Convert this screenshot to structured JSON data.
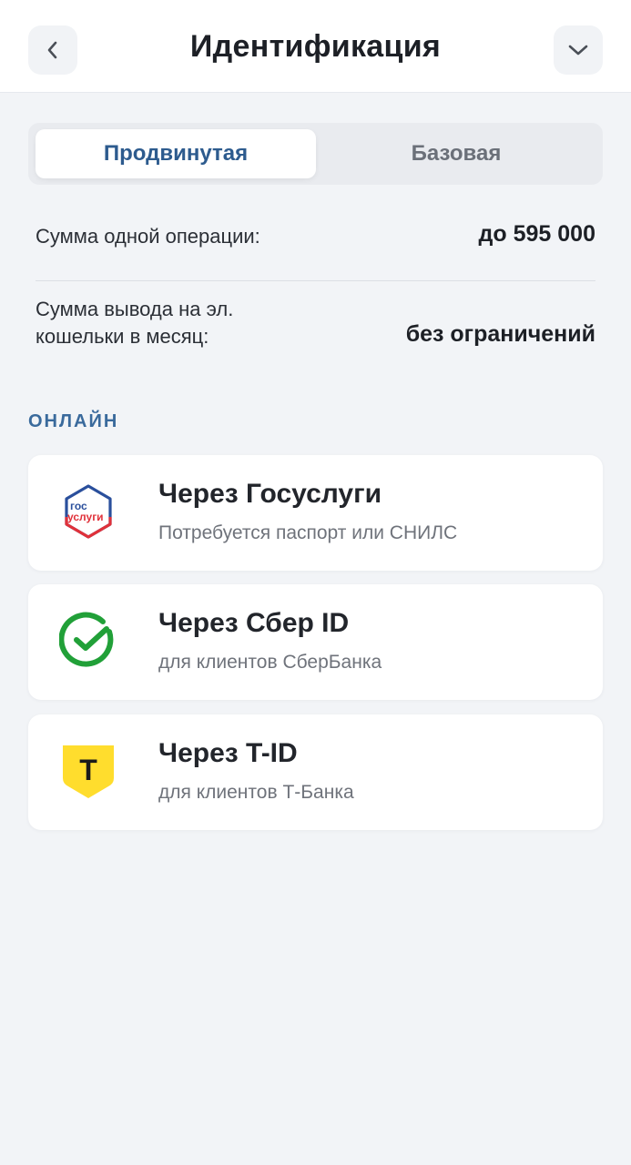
{
  "header": {
    "title": "Идентификация",
    "back_icon": "chevron-left-icon",
    "menu_icon": "chevron-down-icon"
  },
  "tabs": [
    {
      "label": "Продвинутая",
      "active": true
    },
    {
      "label": "Базовая",
      "active": false
    }
  ],
  "limits": {
    "operation": {
      "label": "Сумма одной операции:",
      "value": "до 595 000"
    },
    "withdrawal": {
      "label_line1": "Сумма вывода на эл.",
      "label_line2": "кошельки в месяц:",
      "value": "без ограничений"
    }
  },
  "section_title": "ОНЛАЙН",
  "methods": [
    {
      "title": "Через Госуслуги",
      "subtitle": "Потребуется паспорт или СНИЛС",
      "icon": "gosuslugi-icon",
      "logo_text_top": "гос",
      "logo_text_bottom": "услуги"
    },
    {
      "title": "Через Сбер ID",
      "subtitle": "для клиентов СберБанка",
      "icon": "sber-icon"
    },
    {
      "title": "Через T-ID",
      "subtitle": "для клиентов Т-Банка",
      "icon": "tbank-icon",
      "logo_letter": "Т"
    }
  ],
  "colors": {
    "accent": "#2d5b8e",
    "background": "#f2f4f7",
    "sber_green": "#21a038",
    "tbank_yellow": "#ffdd2d",
    "gos_blue": "#2a4f9c",
    "gos_red": "#e0313a"
  }
}
